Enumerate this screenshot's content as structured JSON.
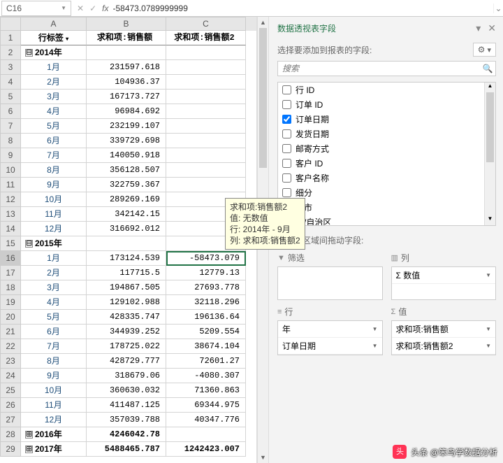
{
  "formula_bar": {
    "cell_ref": "C16",
    "fx": "fx",
    "value": "-58473.0789999999"
  },
  "columns": [
    "A",
    "B",
    "C"
  ],
  "header_row": {
    "a": "行标签",
    "b": "求和项:销售额",
    "c": "求和项:销售额2"
  },
  "rows": [
    {
      "n": 2,
      "type": "yr",
      "exp": "⊟",
      "a": "2014年",
      "b": "",
      "c": ""
    },
    {
      "n": 3,
      "a": "1月",
      "b": "231597.618",
      "c": ""
    },
    {
      "n": 4,
      "a": "2月",
      "b": "104936.37",
      "c": ""
    },
    {
      "n": 5,
      "a": "3月",
      "b": "167173.727",
      "c": ""
    },
    {
      "n": 6,
      "a": "4月",
      "b": "96984.692",
      "c": ""
    },
    {
      "n": 7,
      "a": "5月",
      "b": "232199.107",
      "c": ""
    },
    {
      "n": 8,
      "a": "6月",
      "b": "339729.698",
      "c": ""
    },
    {
      "n": 9,
      "a": "7月",
      "b": "140050.918",
      "c": ""
    },
    {
      "n": 10,
      "a": "8月",
      "b": "356128.507",
      "c": ""
    },
    {
      "n": 11,
      "a": "9月",
      "b": "322759.367",
      "c": ""
    },
    {
      "n": 12,
      "a": "10月",
      "b": "289269.169",
      "c": ""
    },
    {
      "n": 13,
      "a": "11月",
      "b": "342142.15",
      "c": ""
    },
    {
      "n": 14,
      "a": "12月",
      "b": "316692.012",
      "c": ""
    },
    {
      "n": 15,
      "type": "yr",
      "exp": "⊟",
      "a": "2015年",
      "b": "",
      "c": ""
    },
    {
      "n": 16,
      "a": "1月",
      "b": "173124.539",
      "c": "-58473.079",
      "sel": true
    },
    {
      "n": 17,
      "a": "2月",
      "b": "117715.5",
      "c": "12779.13"
    },
    {
      "n": 18,
      "a": "3月",
      "b": "194867.505",
      "c": "27693.778"
    },
    {
      "n": 19,
      "a": "4月",
      "b": "129102.988",
      "c": "32118.296"
    },
    {
      "n": 20,
      "a": "5月",
      "b": "428335.747",
      "c": "196136.64"
    },
    {
      "n": 21,
      "a": "6月",
      "b": "344939.252",
      "c": "5209.554"
    },
    {
      "n": 22,
      "a": "7月",
      "b": "178725.022",
      "c": "38674.104"
    },
    {
      "n": 23,
      "a": "8月",
      "b": "428729.777",
      "c": "72601.27"
    },
    {
      "n": 24,
      "a": "9月",
      "b": "318679.06",
      "c": "-4080.307"
    },
    {
      "n": 25,
      "a": "10月",
      "b": "360630.032",
      "c": "71360.863"
    },
    {
      "n": 26,
      "a": "11月",
      "b": "411487.125",
      "c": "69344.975"
    },
    {
      "n": 27,
      "a": "12月",
      "b": "357039.788",
      "c": "40347.776"
    },
    {
      "n": 28,
      "type": "yr",
      "exp": "⊞",
      "a": "2016年",
      "b": "4246042.78",
      "c": ""
    },
    {
      "n": 29,
      "type": "yr",
      "exp": "⊞",
      "a": "2017年",
      "b": "5488465.787",
      "c": "1242423.007"
    }
  ],
  "tooltip": {
    "l1": "求和项:销售额2",
    "l2": "值: 无数值",
    "l3": "行: 2014年 - 9月",
    "l4": "列: 求和项:销售额2"
  },
  "pane": {
    "title": "数据透视表字段",
    "subtitle": "选择要添加到报表的字段:",
    "search_placeholder": "搜索",
    "fields": [
      {
        "label": "行 ID",
        "checked": false
      },
      {
        "label": "订单 ID",
        "checked": false
      },
      {
        "label": "订单日期",
        "checked": true
      },
      {
        "label": "发货日期",
        "checked": false
      },
      {
        "label": "邮寄方式",
        "checked": false
      },
      {
        "label": "客户 ID",
        "checked": false
      },
      {
        "label": "客户名称",
        "checked": false,
        "partial": true
      },
      {
        "label": "细分",
        "checked": false,
        "partial": true
      },
      {
        "label": "城市",
        "checked": false,
        "partial": true
      },
      {
        "label": "省/自治区",
        "checked": false,
        "partial": true
      }
    ],
    "areas_label": "在以下区域间拖动字段:",
    "filter": {
      "title": "筛选"
    },
    "cols": {
      "title": "列",
      "items": [
        "Σ 数值"
      ]
    },
    "rowsA": {
      "title": "行",
      "items": [
        "年",
        "订单日期"
      ]
    },
    "vals": {
      "title": "值",
      "items": [
        "求和项:销售额",
        "求和项:销售额2"
      ]
    }
  },
  "watermark": {
    "logo": "头",
    "text": "头条 @笨鸟学数据分析"
  }
}
